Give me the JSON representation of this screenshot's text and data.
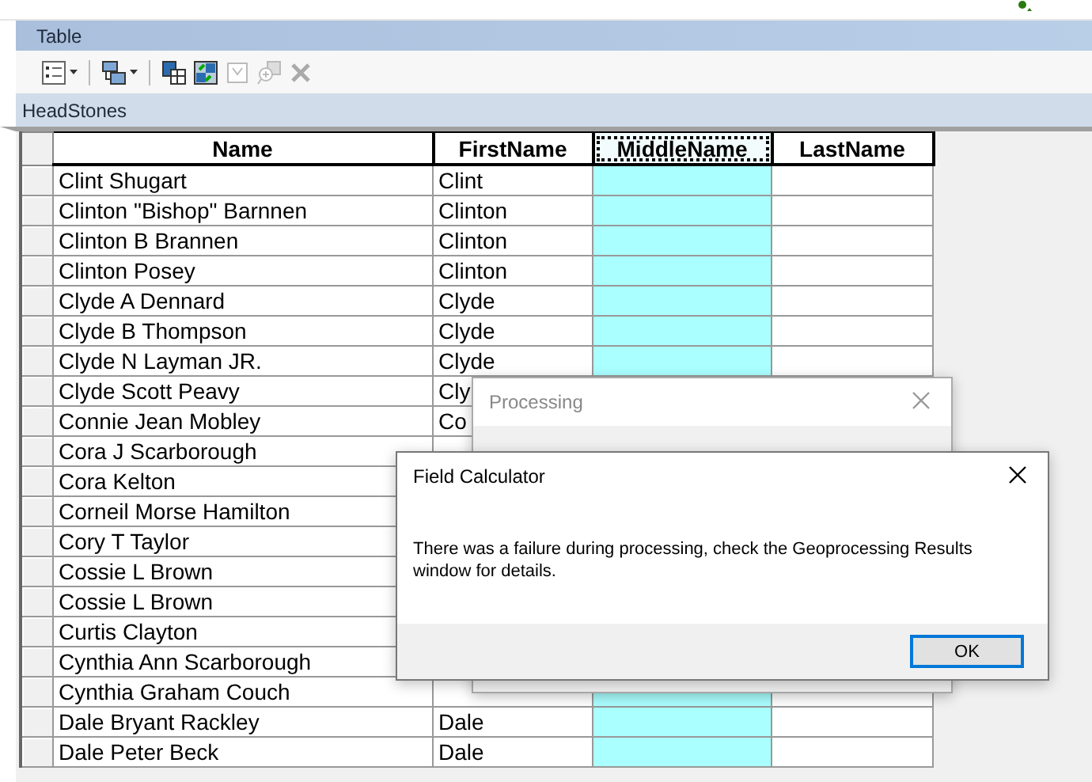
{
  "window": {
    "title": "Table"
  },
  "toolbar": [
    {
      "kind": "options",
      "dropdown": true,
      "disabled": false
    },
    {
      "kind": "related",
      "dropdown": true,
      "disabled": false
    },
    {
      "kind": "select-by",
      "dropdown": false,
      "disabled": false
    },
    {
      "kind": "switch",
      "dropdown": false,
      "disabled": false
    },
    {
      "kind": "clear",
      "dropdown": false,
      "disabled": true
    },
    {
      "kind": "zoom",
      "dropdown": false,
      "disabled": true
    },
    {
      "kind": "delete",
      "dropdown": false,
      "disabled": true
    }
  ],
  "table_name": "HeadStones",
  "table": {
    "columns": [
      {
        "label": "Name",
        "selected": false
      },
      {
        "label": "FirstName",
        "selected": false
      },
      {
        "label": "MiddleName",
        "selected": true
      },
      {
        "label": "LastName",
        "selected": false
      }
    ],
    "rows": [
      {
        "selected": false,
        "cells": [
          "Clint Shugart",
          "Clint",
          "",
          ""
        ]
      },
      {
        "selected": false,
        "cells": [
          "Clinton \"Bishop\" Barnnen",
          "Clinton",
          "",
          ""
        ]
      },
      {
        "selected": false,
        "cells": [
          "Clinton B Brannen",
          "Clinton",
          "",
          ""
        ]
      },
      {
        "selected": false,
        "cells": [
          "Clinton Posey",
          "Clinton",
          "",
          ""
        ]
      },
      {
        "selected": false,
        "cells": [
          "Clyde A Dennard",
          "Clyde",
          "",
          ""
        ]
      },
      {
        "selected": false,
        "cells": [
          "Clyde B Thompson",
          "Clyde",
          "",
          ""
        ]
      },
      {
        "selected": false,
        "cells": [
          "Clyde N Layman JR.",
          "Clyde",
          "",
          ""
        ]
      },
      {
        "selected": false,
        "cells": [
          "Clyde Scott Peavy",
          "Cly",
          "",
          ""
        ]
      },
      {
        "selected": false,
        "cells": [
          "Connie Jean Mobley",
          "Co",
          "",
          ""
        ]
      },
      {
        "selected": false,
        "cells": [
          "Cora J Scarborough",
          "",
          "",
          ""
        ]
      },
      {
        "selected": false,
        "cells": [
          "Cora Kelton",
          "",
          "",
          ""
        ]
      },
      {
        "selected": false,
        "cells": [
          "Corneil Morse Hamilton",
          "",
          "",
          ""
        ]
      },
      {
        "selected": false,
        "cells": [
          "Cory T Taylor",
          "",
          "",
          ""
        ]
      },
      {
        "selected": false,
        "cells": [
          "Cossie L Brown",
          "",
          "",
          ""
        ]
      },
      {
        "selected": false,
        "cells": [
          "Cossie L Brown",
          "",
          "",
          ""
        ]
      },
      {
        "selected": false,
        "cells": [
          "Curtis Clayton",
          "",
          "",
          ""
        ]
      },
      {
        "selected": false,
        "cells": [
          "Cynthia Ann Scarborough",
          "",
          "",
          ""
        ]
      },
      {
        "selected": false,
        "cells": [
          "Cynthia Graham Couch",
          "",
          "",
          ""
        ]
      },
      {
        "selected": false,
        "cells": [
          "Dale Bryant Rackley",
          "Dale",
          "",
          ""
        ]
      },
      {
        "selected": false,
        "cells": [
          "Dale Peter Beck",
          "Dale",
          "",
          ""
        ]
      }
    ]
  },
  "processing_dialog": {
    "title": "Processing",
    "active": false
  },
  "field_calculator_dialog": {
    "title": "Field Calculator",
    "active": true,
    "message": "There was a failure during processing, check the Geoprocessing Results window for details.",
    "buttons": [
      "OK"
    ]
  }
}
